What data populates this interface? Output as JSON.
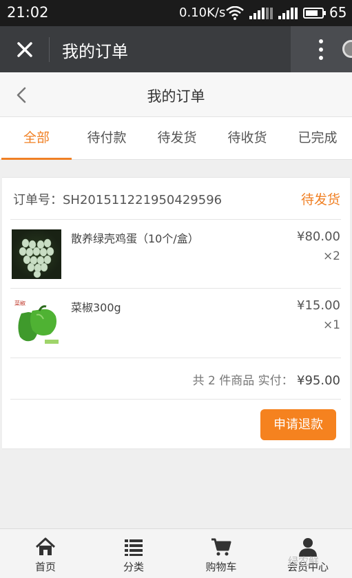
{
  "status_bar": {
    "time": "21:02",
    "network_speed": "0.10K/s",
    "battery_percent": "65"
  },
  "app_bar": {
    "title": "我的订单"
  },
  "page_header": {
    "title": "我的订单"
  },
  "tabs": [
    {
      "label": "全部",
      "active": true
    },
    {
      "label": "待付款",
      "active": false
    },
    {
      "label": "待发货",
      "active": false
    },
    {
      "label": "待收货",
      "active": false
    },
    {
      "label": "已完成",
      "active": false
    }
  ],
  "order": {
    "number_label": "订单号：SH2015112219504 29596",
    "number": "订单号：SH201511221950429596",
    "status": "待发货",
    "items": [
      {
        "name": "散养绿壳鸡蛋（10个/盒）",
        "price": "¥80.00",
        "qty": "×2",
        "thumb_icon": "green-eggs-image"
      },
      {
        "name": "菜椒300g",
        "price": "¥15.00",
        "qty": "×1",
        "thumb_icon": "green-pepper-image"
      }
    ],
    "summary": "共 2 件商品 实付：",
    "total": "¥95.00",
    "refund_label": "申请退款"
  },
  "bottom_nav": [
    {
      "label": "首页",
      "icon": "home-icon"
    },
    {
      "label": "分类",
      "icon": "list-icon"
    },
    {
      "label": "购物车",
      "icon": "cart-icon"
    },
    {
      "label": "会员中心",
      "icon": "user-icon"
    }
  ],
  "watermark": "绿农鲜",
  "colors": {
    "accent": "#f08024",
    "app_bar": "#3a3c3f",
    "status_bar": "#1b1b1b"
  }
}
